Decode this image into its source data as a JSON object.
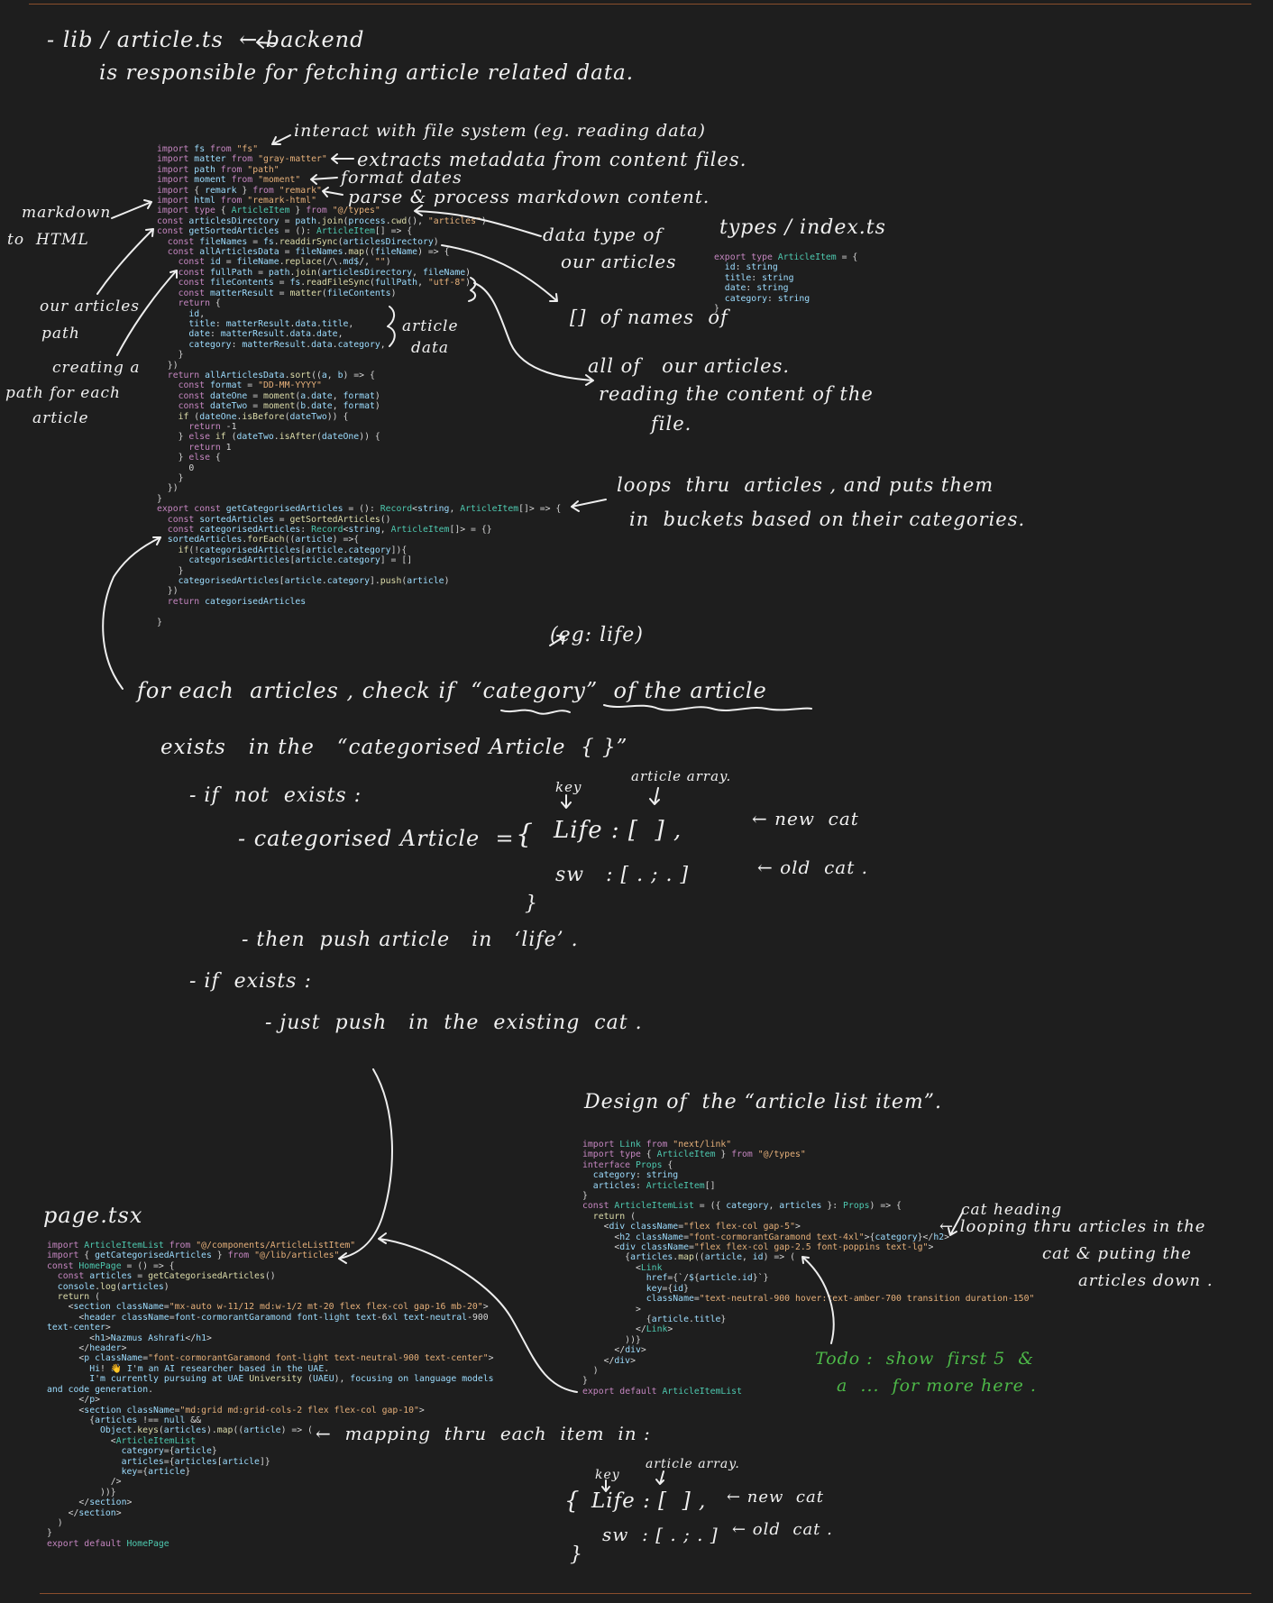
{
  "notes": {
    "header_line1": "- lib / article.ts  ← backend",
    "header_line2": "is responsible for fetching article related data.",
    "import_fs": "interact with file system (eg. reading data)",
    "import_matter": "extracts metadata from content files.",
    "import_moment": "format dates",
    "import_remark": "parse & process markdown content.",
    "markdown_to_html_1": "markdown",
    "markdown_to_html_2": "to  HTML",
    "data_type_1": "data type of",
    "data_type_2": "our articles",
    "types_file": "types / index.ts",
    "array_names_1": "[]  of names  of",
    "array_names_2": "all of   our articles.",
    "reading_content_1": "reading the content of the",
    "reading_content_2": "file.",
    "articles_path_1": "our articles",
    "articles_path_2": "path",
    "creating_path_1": "creating a",
    "creating_path_2": "path for each",
    "creating_path_3": "article",
    "article_data_1": "article",
    "article_data_2": "data",
    "loops_1": "loops  thru  articles , and puts them",
    "loops_2": "in  buckets based on their categories.",
    "eg_life": "(eg: life)",
    "foreach_1": "for each  articles , check if  “category”  of the article",
    "foreach_2": "exists   in the   “categorised Article  { }”",
    "if_not_exists": "- if  not  exists :",
    "key_label": "key",
    "article_array_label": "article array.",
    "categorised_eq": "- categorised Article  =",
    "brace_open": "{",
    "life_entry": "Life : [  ] ,",
    "new_cat": "← new  cat",
    "sw_entry": "sw   : [ . ; . ]",
    "old_cat": "← old  cat .",
    "brace_close": "}",
    "then_push": "- then  push article   in   ‘life’ .",
    "if_exists": "- if  exists :",
    "just_push": "- just  push   in  the  existing  cat .",
    "design_title": "Design of  the “article list item”.",
    "page_tsx": "page.tsx",
    "cat_heading": "cat heading",
    "looping_1": "← looping thru articles in the",
    "looping_2": "cat & puting the",
    "looping_3": "articles down .",
    "todo_1": "Todo :  show  first 5  &",
    "todo_2": "a  ...  for more here .",
    "mapping": "←  mapping  thru  each  item  in :",
    "key_label_2": "key",
    "article_array_label_2": "article array.",
    "brace_open_2": "{",
    "life_entry_2": "Life : [  ] ,",
    "new_cat_2": "← new  cat",
    "sw_entry_2": "sw  : [ . ; . ]",
    "old_cat_2": "← old  cat .",
    "brace_close_2": "}"
  },
  "code": {
    "article_ts": [
      "import fs from \"fs\"",
      "import matter from \"gray-matter\"",
      "import path from \"path\"",
      "import moment from \"moment\"",
      "import { remark } from \"remark\"",
      "import html from \"remark-html\"",
      "import type { ArticleItem } from \"@/types\"",
      "const articlesDirectory = path.join(process.cwd(), \"articles\")",
      "const getSortedArticles = (): ArticleItem[] => {",
      "  const fileNames = fs.readdirSync(articlesDirectory)",
      "  const allArticlesData = fileNames.map((fileName) => {",
      "    const id = fileName.replace(/\\.md$/, \"\")",
      "    const fullPath = path.join(articlesDirectory, fileName)",
      "    const fileContents = fs.readFileSync(fullPath, \"utf-8\")",
      "    const matterResult = matter(fileContents)",
      "    return {",
      "      id,",
      "      title: matterResult.data.title,",
      "      date: matterResult.data.date,",
      "      category: matterResult.data.category,",
      "    }",
      "  })",
      "  return allArticlesData.sort((a, b) => {",
      "    const format = \"DD-MM-YYYY\"",
      "    const dateOne = moment(a.date, format)",
      "    const dateTwo = moment(b.date, format)",
      "    if (dateOne.isBefore(dateTwo)) {",
      "      return -1",
      "    } else if (dateTwo.isAfter(dateOne)) {",
      "      return 1",
      "    } else {",
      "      0",
      "    }",
      "  })",
      "}",
      "export const getCategorisedArticles = (): Record<string, ArticleItem[]> => {",
      "  const sortedArticles = getSortedArticles()",
      "  const categorisedArticles: Record<string, ArticleItem[]> = {}",
      "  sortedArticles.forEach((article) =>{",
      "    if(!categorisedArticles[article.category]){",
      "      categorisedArticles[article.category] = []",
      "    }",
      "    categorisedArticles[article.category].push(article)",
      "  })",
      "  return categorisedArticles",
      "",
      "}"
    ],
    "types_ts": [
      "export type ArticleItem = {",
      "  id: string",
      "  title: string",
      "  date: string",
      "  category: string",
      "}"
    ],
    "list_item_tsx": [
      "import Link from \"next/link\"",
      "import type { ArticleItem } from \"@/types\"",
      "interface Props {",
      "  category: string",
      "  articles: ArticleItem[]",
      "}",
      "const ArticleItemList = ({ category, articles }: Props) => {",
      "  return (",
      "    <div className=\"flex flex-col gap-5\">",
      "      <h2 className=\"font-cormorantGaramond text-4xl\">{category}</h2>",
      "      <div className=\"flex flex-col gap-2.5 font-poppins text-lg\">",
      "        {articles.map((article, id) => (",
      "          <Link",
      "            href={`/${article.id}`}",
      "            key={id}",
      "            className=\"text-neutral-900 hover:text-amber-700 transition duration-150\"",
      "          >",
      "            {article.title}",
      "          </Link>",
      "        ))}",
      "      </div>",
      "    </div>",
      "  )",
      "}",
      "export default ArticleItemList"
    ],
    "page_tsx": [
      "import ArticleItemList from \"@/components/ArticleListItem\"",
      "import { getCategorisedArticles } from \"@/lib/articles\"",
      "const HomePage = () => {",
      "  const articles = getCategorisedArticles()",
      "  console.log(articles)",
      "  return (",
      "    <section className=\"mx-auto w-11/12 md:w-1/2 mt-20 flex flex-col gap-16 mb-20\">",
      "      <header className=\"font-cormorantGaramond font-light text-6xl text-neutral-900",
      "text-center\">",
      "        <h1>Nazmus Ashrafi</h1>",
      "      </header>",
      "      <p className=\"font-cormorantGaramond font-light text-neutral-900 text-center\">",
      "        Hi! 👋 I'm an AI researcher based in the UAE.",
      "        I'm currently pursuing at UAE University (UAEU), focusing on language models",
      "and code generation.",
      "      </p>",
      "      <section className=\"md:grid md:grid-cols-2 flex flex-col gap-10\">",
      "        {articles !== null &&",
      "          Object.keys(articles).map((article) => (",
      "            <ArticleItemList",
      "              category={article}",
      "              articles={articles[article]}",
      "              key={article}",
      "            />",
      "          ))}",
      "      </section>",
      "    </section>",
      "  )",
      "}",
      "export default HomePage"
    ]
  }
}
